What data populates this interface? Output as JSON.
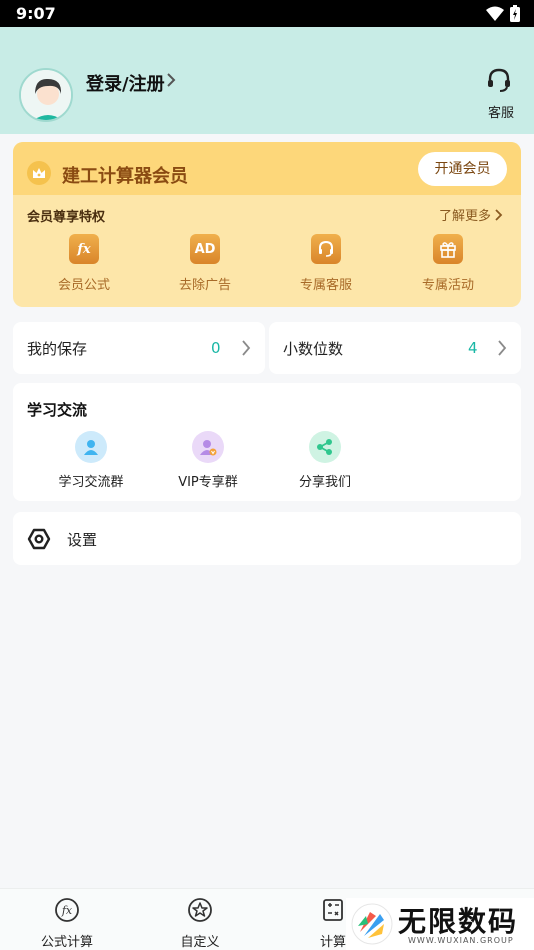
{
  "status_bar": {
    "time": "9:07"
  },
  "header": {
    "login_label": "登录/注册",
    "service_label": "客服"
  },
  "vip": {
    "title": "建工计算器会员",
    "open_button": "开通会员",
    "subtitle": "会员尊享特权",
    "more_link": "了解更多",
    "perks": [
      {
        "label": "会员公式",
        "icon": "fx-icon"
      },
      {
        "label": "去除广告",
        "icon": "ad-icon"
      },
      {
        "label": "专属客服",
        "icon": "headset-icon"
      },
      {
        "label": "专属活动",
        "icon": "gift-icon"
      }
    ]
  },
  "saves": {
    "label": "我的保存",
    "value": "0"
  },
  "decimals": {
    "label": "小数位数",
    "value": "4"
  },
  "study": {
    "title": "学习交流",
    "items": [
      {
        "label": "学习交流群",
        "icon": "group-icon",
        "color": "#3fb4f0"
      },
      {
        "label": "VIP专享群",
        "icon": "vip-group-icon",
        "color": "#b58be6"
      },
      {
        "label": "分享我们",
        "icon": "share-icon",
        "color": "#2fc78e"
      }
    ]
  },
  "settings": {
    "label": "设置"
  },
  "tabbar": {
    "tabs": [
      {
        "label": "公式计算",
        "icon": "fx-circle-icon"
      },
      {
        "label": "自定义",
        "icon": "star-circle-icon"
      },
      {
        "label": "计算",
        "icon": "calculator-icon"
      }
    ]
  },
  "watermark": {
    "title": "无限数码",
    "subtitle": "WWW.WUXIAN.GROUP"
  },
  "colors": {
    "accent": "#19b7a5",
    "header_bg": "#c8ece6",
    "vip_bg": "#fde6a9",
    "vip_title": "#8a4b12"
  }
}
